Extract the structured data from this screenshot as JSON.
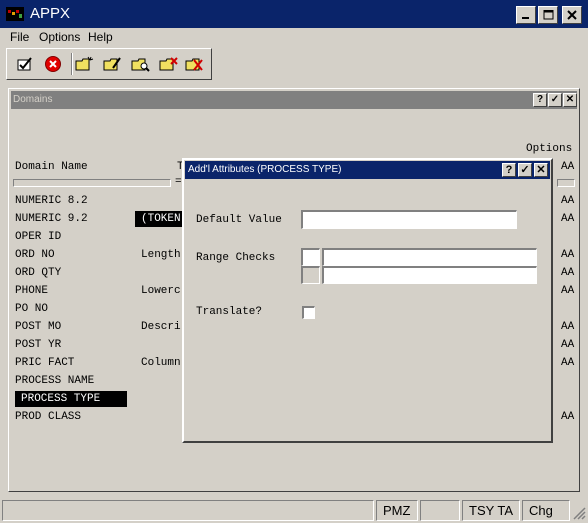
{
  "app": {
    "title": "APPX",
    "icon_text": "APPX"
  },
  "window_controls": {
    "minimize": "_",
    "maximize": "□",
    "close": "✕"
  },
  "menu": {
    "items": [
      "File",
      "Options",
      "Help"
    ]
  },
  "toolbar": {
    "buttons": [
      "check-icon",
      "cancel-icon",
      "folder-new-icon",
      "folder-edit-icon",
      "folder-search-icon",
      "folder-delete-icon",
      "folder-x-icon"
    ]
  },
  "domains_window": {
    "title": "Domains",
    "controls": [
      "?",
      "✓",
      "✕"
    ],
    "options_header": "Options",
    "domain_name_header": "Domain Name",
    "type_header_fragment": "T",
    "equals_sign": "=",
    "rows": [
      {
        "name": "NUMERIC 8.2",
        "mid": "",
        "option": "AA"
      },
      {
        "name": "NUMERIC 9.2",
        "mid": "(TOKEN",
        "option": "AA"
      },
      {
        "name": "OPER ID",
        "mid": "",
        "option": ""
      },
      {
        "name": "ORD NO",
        "mid": "Length",
        "option": "AA"
      },
      {
        "name": "ORD QTY",
        "mid": "",
        "option": "AA"
      },
      {
        "name": "PHONE",
        "mid": "Lowerc",
        "option": "AA"
      },
      {
        "name": "PO NO",
        "mid": "",
        "option": ""
      },
      {
        "name": "POST MO",
        "mid": "Descri",
        "option": "AA"
      },
      {
        "name": "POST YR",
        "mid": "",
        "option": "AA"
      },
      {
        "name": "PRIC FACT",
        "mid": "Column",
        "option": "AA"
      },
      {
        "name": "PROCESS NAME",
        "mid": "",
        "option": ""
      },
      {
        "name": "PROCESS TYPE",
        "mid": "",
        "option": ""
      },
      {
        "name": "PROD CLASS",
        "mid": "",
        "option": "AA"
      }
    ],
    "header_option": "AA"
  },
  "dialog": {
    "title": "Add'l Attributes (PROCESS TYPE)",
    "controls": [
      "?",
      "✓",
      "✕"
    ],
    "default_value_label": "Default Value",
    "default_value": "",
    "range_checks_label": "Range Checks",
    "range_low_flag": "",
    "range_low": "",
    "range_high_flag": "",
    "range_high": "",
    "translate_label": "Translate?",
    "translate_checked": false
  },
  "status_bar": {
    "cells": [
      "",
      "PMZ",
      "",
      "TSY TA",
      "Chg"
    ]
  }
}
